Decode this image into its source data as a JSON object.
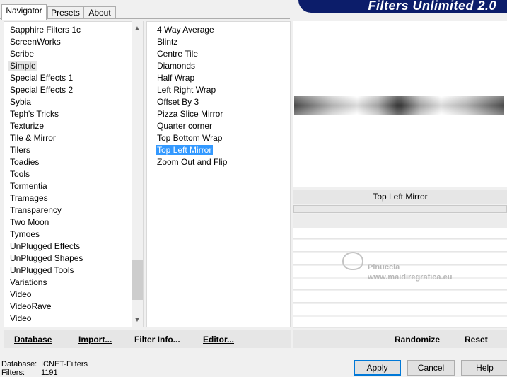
{
  "tabs": [
    {
      "label": "Navigator",
      "active": true
    },
    {
      "label": "Presets",
      "active": false
    },
    {
      "label": "About",
      "active": false
    }
  ],
  "brand_title": "Filters Unlimited 2.0",
  "categories": {
    "selected": "Simple",
    "items": [
      "Sapphire Filters 1c",
      "ScreenWorks",
      "Scribe",
      "Simple",
      "Special Effects 1",
      "Special Effects 2",
      "Sybia",
      "Teph's Tricks",
      "Texturize",
      "Tile & Mirror",
      "Tilers",
      "Toadies",
      "Tools",
      "Tormentia",
      "Tramages",
      "Transparency",
      "Two Moon",
      "Tymoes",
      "UnPlugged Effects",
      "UnPlugged Shapes",
      "UnPlugged Tools",
      "Variations",
      "Video",
      "VideoRave",
      "Video"
    ]
  },
  "filters": {
    "selected": "Top Left Mirror",
    "items": [
      "4 Way Average",
      "Blintz",
      "Centre Tile",
      "Diamonds",
      "Half Wrap",
      "Left Right Wrap",
      "Offset By 3",
      "Pizza Slice Mirror",
      "Quarter corner",
      "Top Bottom Wrap",
      "Top Left Mirror",
      "Zoom Out and Flip"
    ]
  },
  "preview": {
    "filter_name": "Top Left Mirror",
    "watermark_line1": "Pinuccia",
    "watermark_line2": "www.maidiregrafica.eu"
  },
  "left_buttons": {
    "database": "Database",
    "import": "Import...",
    "filter_info": "Filter Info...",
    "editor": "Editor..."
  },
  "right_buttons": {
    "randomize": "Randomize",
    "reset": "Reset"
  },
  "status": {
    "database_label": "Database:",
    "database_value": "ICNET-Filters",
    "filters_label": "Filters:",
    "filters_value": "1191"
  },
  "dialog_buttons": {
    "apply": "Apply",
    "cancel": "Cancel",
    "help": "Help"
  },
  "colors": {
    "selection": "#3399ff",
    "brand": "#0c1d6a"
  }
}
